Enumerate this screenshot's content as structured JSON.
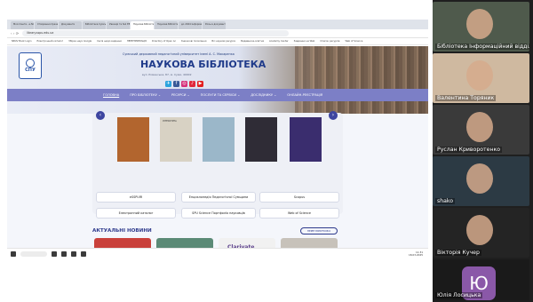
{
  "browser": {
    "tabs": [
      "Моя пошта - e.NUB.Bu",
      "Створення презентацій",
      "Документи",
      "Бібліотека Сумського",
      "Увечері та №1 ЕБ",
      "Наукова Бібліотека",
      "Наукова Бібліотека",
      "до 2024 Інформаційні",
      "Роль в документах"
    ],
    "active_tab_index": 5,
    "url": "library.sspu.edu.ua",
    "bookmarks": [
      "NBUV Book Login",
      "Електронний каталог",
      "Збірка наук Google",
      "Сесія щодо видання",
      "ПЕРЕНУМЕРАЦІЯ",
      "Directory of Open Ac",
      "Книжкові посилання",
      "Всі наукові ресурси",
      "Видавнича-освітня",
      "Academy Center",
      "Завдання на Web",
      "Список ресурсів",
      "Web of Science"
    ]
  },
  "site": {
    "logo_text": "СПУ",
    "university_name": "Сумський державний педагогічний університет імені А. С. Макаренка",
    "title": "НАУКОВА БІБЛІОТЕКА",
    "subtitle": "вул. Роменська, 87, м. Суми, 40002",
    "socials": [
      {
        "icon": "telegram-icon",
        "glyph": "✈",
        "color": "#2aa3dd"
      },
      {
        "icon": "facebook-icon",
        "glyph": "f",
        "color": "#3a5a98"
      },
      {
        "icon": "instagram-icon",
        "glyph": "◎",
        "color": "#d6317a"
      },
      {
        "icon": "tiktok-icon",
        "glyph": "♪",
        "color": "#e0283c"
      },
      {
        "icon": "youtube-icon",
        "glyph": "▶",
        "color": "#e21f1f"
      }
    ],
    "menu": [
      "ГОЛОВНА",
      "ПРО БІБЛІОТЕКУ ⌄",
      "РЕСУРСИ ⌄",
      "ПОСЛУГИ ТА СЕРВІСИ ⌄",
      "ДОСЛІДНИКУ ⌄",
      "ОНЛАЙН-РЕЄСТРАЦІЯ"
    ],
    "books": [
      {
        "title": "",
        "color": "#b2652e"
      },
      {
        "title": "ЛІТЕРАТУРА",
        "color": "#d8d2c4"
      },
      {
        "title": "",
        "color": "#9bb7c9"
      },
      {
        "title": "",
        "color": "#2f2c36"
      },
      {
        "title": "",
        "color": "#3a2d6e"
      }
    ],
    "resources": [
      "eSSPUIR",
      "Енциклопедія Педагогічної Сумщини",
      "Scopus",
      "Електронний каталог",
      "SPU Science Портфоліо науковців",
      "Web of Science"
    ],
    "news_title": "АКТУАЛЬНІ НОВИНИ",
    "news_button": "ПЕРЕГЛЯНУТИ ВСІ",
    "news_cards": [
      {
        "caption": "",
        "color": "#c9413b"
      },
      {
        "caption": "",
        "color": "#5b8a76"
      },
      {
        "caption": "Clarivate",
        "color": "#f1f1f1"
      },
      {
        "caption": "",
        "color": "#c7c2ba"
      }
    ]
  },
  "taskbar": {
    "time": "11:31",
    "date": "18.03.2025"
  },
  "participants": [
    {
      "name": "Бібліотека Інформаційний відділ",
      "bg": "#4f5a4c"
    },
    {
      "name": "Валентина Торяник",
      "bg": "#cfb9a0"
    },
    {
      "name": "Руслан Криворотенко",
      "bg": "#3a3a3a"
    },
    {
      "name": "shako",
      "bg": "#2c3a44"
    },
    {
      "name": "Вікторія Кучер",
      "bg": "#242424"
    },
    {
      "name": "Юлія Лосицька",
      "bg": "#1a1a1a",
      "initial": "Ю"
    }
  ]
}
